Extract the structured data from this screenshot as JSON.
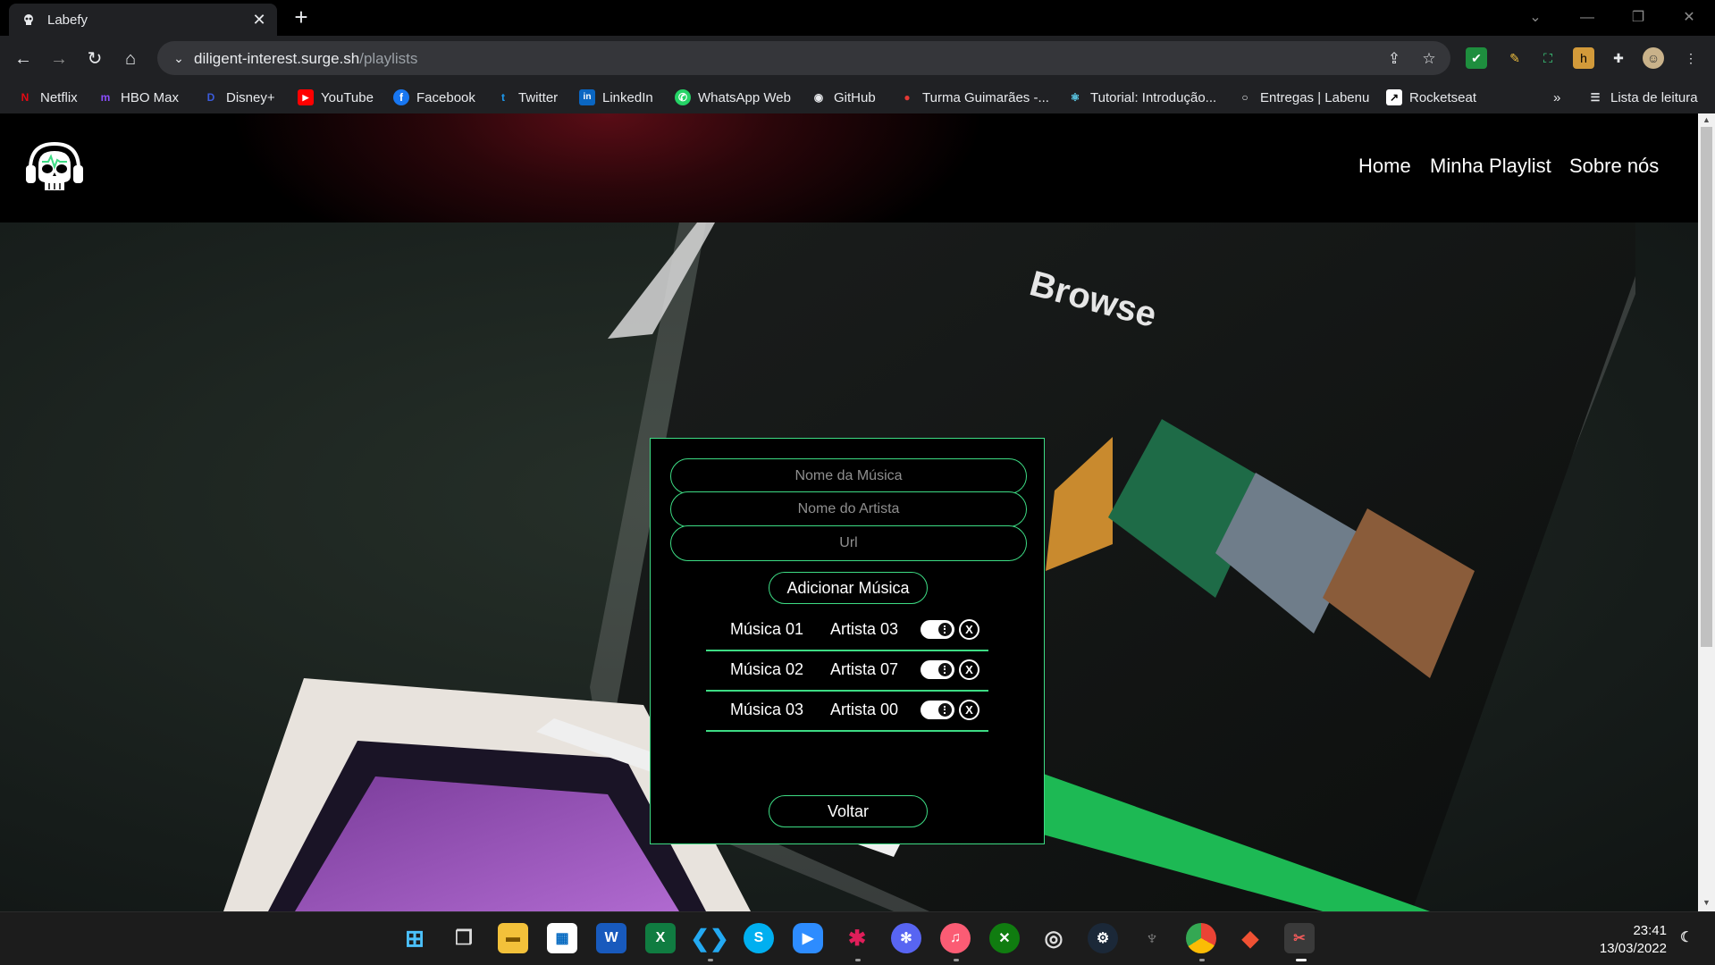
{
  "browser": {
    "tab_title": "Labefy",
    "url_domain": "diligent-interest.surge.sh",
    "url_path": "/playlists",
    "bookmarks": [
      {
        "label": "Netflix",
        "color": "#e50914",
        "glyph": "N"
      },
      {
        "label": "HBO Max",
        "color": "#7b2cbf",
        "glyph": "m"
      },
      {
        "label": "Disney+",
        "color": "#1e3a8a",
        "glyph": "D"
      },
      {
        "label": "YouTube",
        "color": "#ff0000",
        "glyph": "▶"
      },
      {
        "label": "Facebook",
        "color": "#1877f2",
        "glyph": "f"
      },
      {
        "label": "Twitter",
        "color": "#1d9bf0",
        "glyph": "t"
      },
      {
        "label": "LinkedIn",
        "color": "#0a66c2",
        "glyph": "in"
      },
      {
        "label": "WhatsApp Web",
        "color": "#25d366",
        "glyph": "✆"
      },
      {
        "label": "GitHub",
        "color": "#e8eaed",
        "glyph": "◉"
      },
      {
        "label": "Turma Guimarães -...",
        "color": "#e53935",
        "glyph": "●"
      },
      {
        "label": "Tutorial: Introdução...",
        "color": "#61dafb",
        "glyph": "⚛"
      },
      {
        "label": "Entregas | Labenu",
        "color": "#000000",
        "glyph": "○"
      },
      {
        "label": "Rocketseat",
        "color": "#ffffff",
        "glyph": "↗"
      }
    ],
    "bookmarks_overflow": "»",
    "reading_list": "Lista de leitura"
  },
  "page": {
    "nav": {
      "home": "Home",
      "playlist": "Minha Playlist",
      "about": "Sobre nós"
    },
    "form": {
      "song_placeholder": "Nome da Música",
      "artist_placeholder": "Nome do Artista",
      "url_placeholder": "Url",
      "add_button": "Adicionar Música",
      "back_button": "Voltar"
    },
    "tracks": [
      {
        "song": "Música 01",
        "artist": "Artista 03",
        "delete": "X"
      },
      {
        "song": "Música 02",
        "artist": "Artista 07",
        "delete": "X"
      },
      {
        "song": "Música 03",
        "artist": "Artista 00",
        "delete": "X"
      }
    ],
    "colors": {
      "accent": "#3ddc84",
      "header_glow": "#5a0d16"
    }
  },
  "taskbar": {
    "time": "23:41",
    "date": "13/03/2022"
  }
}
